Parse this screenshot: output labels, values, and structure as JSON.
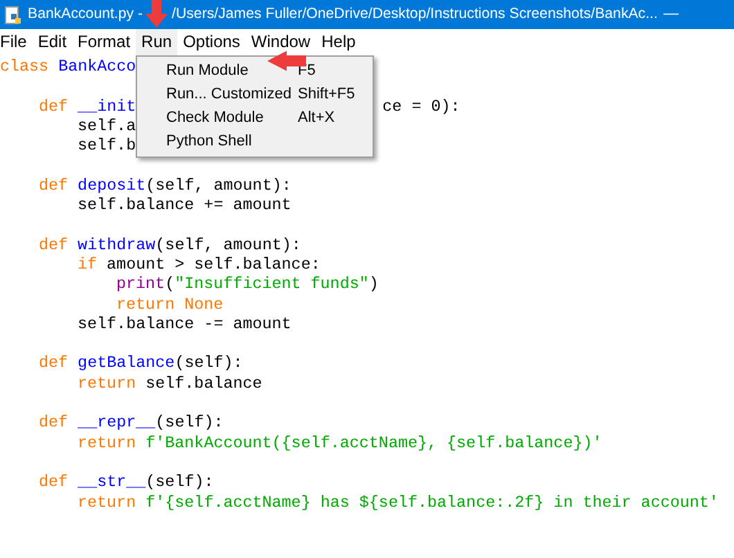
{
  "window": {
    "title_parts": [
      "BankAccount.py -",
      "/Users/James Fuller/OneDrive/Desktop/Instructions Screenshots/BankAc..."
    ],
    "minimize": "—"
  },
  "menu_bar": [
    {
      "label": "File",
      "selected": false
    },
    {
      "label": "Edit",
      "selected": false
    },
    {
      "label": "Format",
      "selected": false
    },
    {
      "label": "Run",
      "selected": true
    },
    {
      "label": "Options",
      "selected": false
    },
    {
      "label": "Window",
      "selected": false
    },
    {
      "label": "Help",
      "selected": false
    }
  ],
  "run_menu": [
    {
      "label": "Run Module",
      "shortcut": "F5"
    },
    {
      "label": "Run... Customized",
      "shortcut": "Shift+F5"
    },
    {
      "label": "Check Module",
      "shortcut": "Alt+X"
    },
    {
      "label": "Python Shell"
    }
  ],
  "code": [
    {
      "segments": [
        {
          "text": "class",
          "kind": "keyword"
        },
        {
          "text": " BankAcco",
          "kind": "name"
        }
      ],
      "children": [
        {
          "blank_before": true,
          "segments": [
            {
              "text": "def",
              "kind": "keyword"
            },
            {
              "text": " __init",
              "kind": "name"
            },
            {
              "text": "ce = 0):",
              "after_menu": true
            }
          ],
          "children": [
            {
              "segments": [
                {
                  "text": "self.a"
                }
              ]
            },
            {
              "segments": [
                {
                  "text": "self.b"
                }
              ]
            }
          ]
        },
        {
          "blank_before": true,
          "segments": [
            {
              "text": "def",
              "kind": "keyword"
            },
            {
              "text": " deposit",
              "kind": "name"
            },
            {
              "text": "(self, amount):"
            }
          ],
          "children": [
            {
              "segments": [
                {
                  "text": "self.balance += amount"
                }
              ]
            }
          ]
        },
        {
          "blank_before": true,
          "segments": [
            {
              "text": "def",
              "kind": "keyword"
            },
            {
              "text": " withdraw",
              "kind": "name"
            },
            {
              "text": "(self, amount):"
            }
          ],
          "children": [
            {
              "segments": [
                {
                  "text": "if",
                  "kind": "keyword"
                },
                {
                  "text": " amount > self.balance:"
                }
              ],
              "children": [
                {
                  "segments": [
                    {
                      "text": "print",
                      "kind": "builtin"
                    },
                    {
                      "text": "("
                    },
                    {
                      "text": "\"Insufficient funds\"",
                      "kind": "string"
                    },
                    {
                      "text": ")"
                    }
                  ]
                },
                {
                  "segments": [
                    {
                      "text": "return None",
                      "kind": "keyword"
                    }
                  ]
                }
              ]
            },
            {
              "segments": [
                {
                  "text": "self.balance -= amount"
                }
              ]
            }
          ]
        },
        {
          "blank_before": true,
          "segments": [
            {
              "text": "def",
              "kind": "keyword"
            },
            {
              "text": " getBalance",
              "kind": "name"
            },
            {
              "text": "(self):"
            }
          ],
          "children": [
            {
              "segments": [
                {
                  "text": "return",
                  "kind": "keyword"
                },
                {
                  "text": " self.balance"
                }
              ]
            }
          ]
        },
        {
          "blank_before": true,
          "segments": [
            {
              "text": "def",
              "kind": "keyword"
            },
            {
              "text": " __repr__",
              "kind": "name"
            },
            {
              "text": "(self):"
            }
          ],
          "children": [
            {
              "segments": [
                {
                  "text": "return",
                  "kind": "keyword"
                },
                {
                  "text": " f'BankAccount({self.acctName}, {self.balance})'",
                  "kind": "string"
                }
              ]
            }
          ]
        },
        {
          "blank_before": true,
          "segments": [
            {
              "text": "def",
              "kind": "keyword"
            },
            {
              "text": " __str__",
              "kind": "name"
            },
            {
              "text": "(self):"
            }
          ],
          "children": [
            {
              "segments": [
                {
                  "text": "return",
                  "kind": "keyword"
                },
                {
                  "text": " f'{self.acctName} has ${self.balance:.2f} in their account'",
                  "kind": "string"
                }
              ]
            }
          ]
        }
      ]
    }
  ]
}
